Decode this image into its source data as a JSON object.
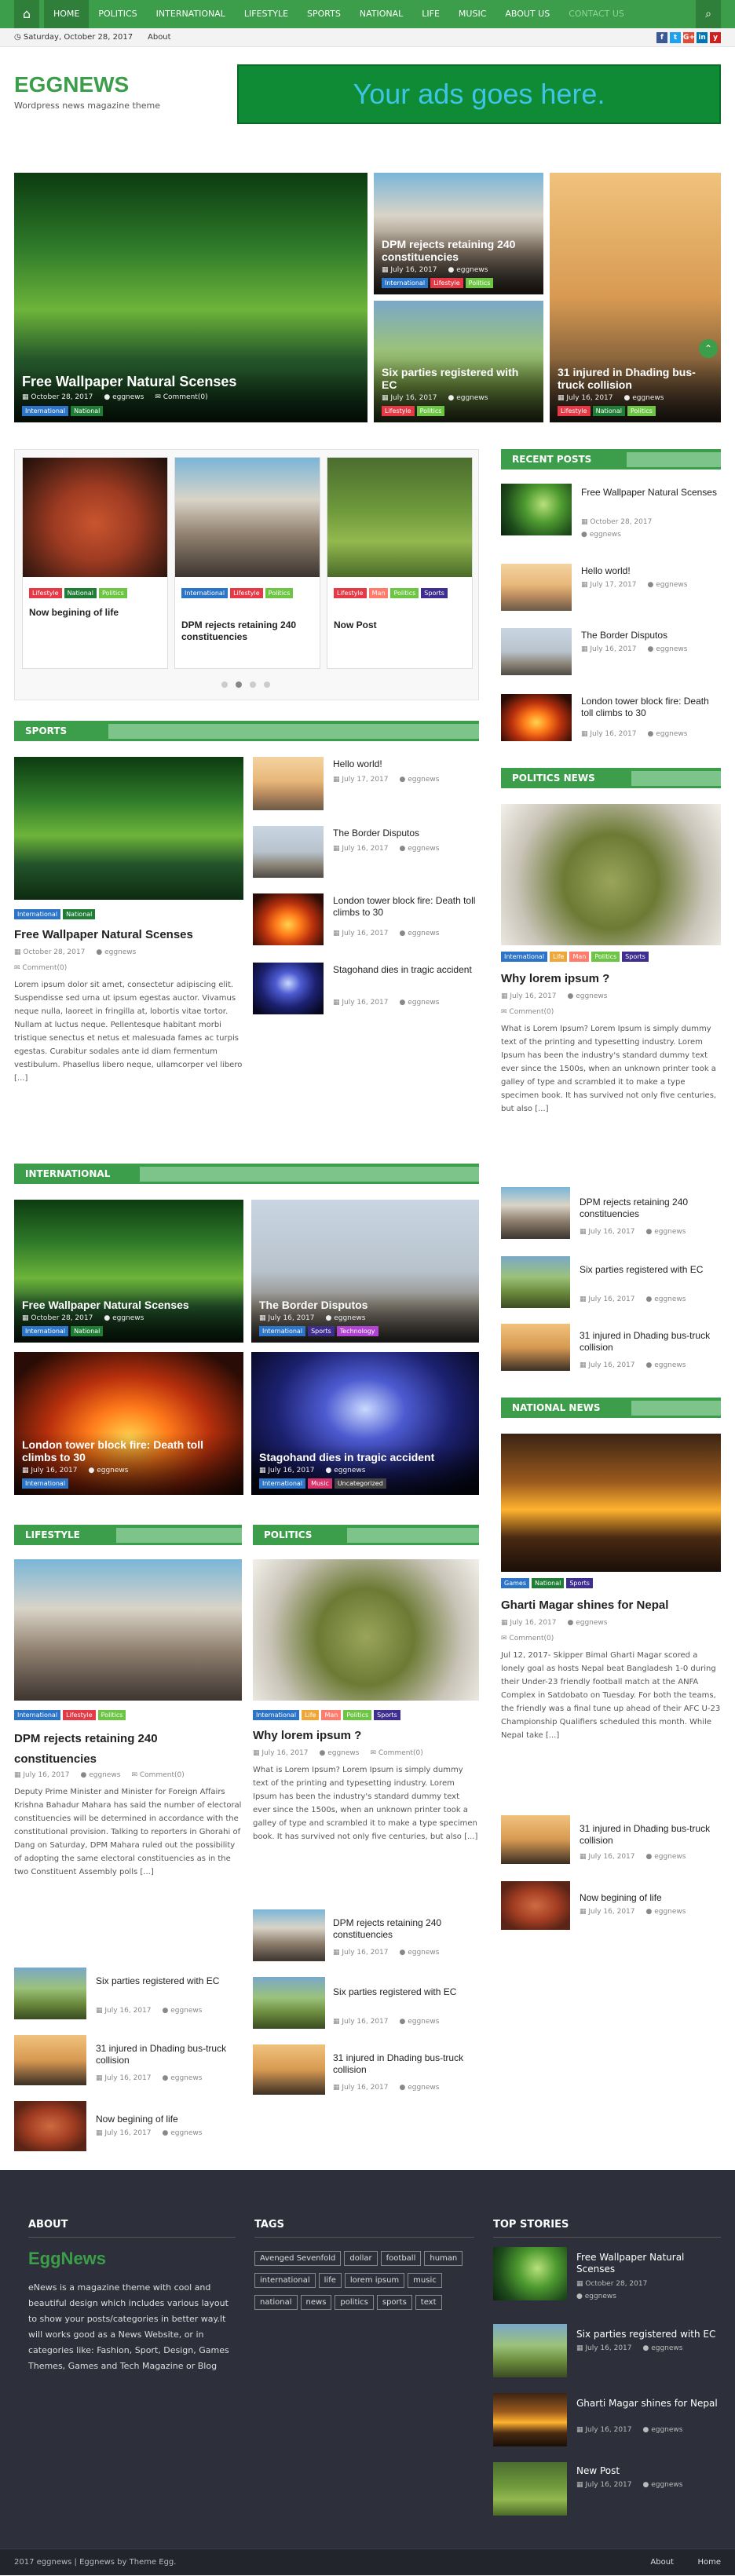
{
  "nav": {
    "items": [
      "HOME",
      "POLITICS",
      "INTERNATIONAL",
      "LIFESTYLE",
      "SPORTS",
      "NATIONAL",
      "LIFE",
      "MUSIC",
      "ABOUT US",
      "CONTACT US"
    ]
  },
  "datebar": {
    "date": "Saturday, October 28, 2017",
    "about": "About",
    "social": [
      "f",
      "t",
      "G+",
      "in",
      "y"
    ]
  },
  "header": {
    "logo": "EGGNEWS",
    "tagline": "Wordpress news magazine theme",
    "ad": "Your ads goes here."
  },
  "slider": {
    "main": {
      "title": "Free Wallpaper Natural Scenses",
      "date": "October 28, 2017",
      "author": "eggnews",
      "comments": "Comment(0)",
      "tags": [
        "International",
        "National"
      ]
    },
    "a": {
      "title": "DPM rejects retaining 240 constituencies",
      "date": "July 16, 2017",
      "author": "eggnews",
      "tags": [
        "International",
        "Lifestyle",
        "Politics"
      ]
    },
    "b": {
      "title": "Six parties registered with EC",
      "date": "July 16, 2017",
      "author": "eggnews",
      "tags": [
        "Lifestyle",
        "Politics"
      ]
    },
    "c": {
      "title": "31 injured in Dhading bus-truck collision",
      "date": "July 16, 2017",
      "author": "eggnews",
      "tags": [
        "Lifestyle",
        "National",
        "Politics"
      ]
    }
  },
  "carousel": [
    {
      "title": "Now begining of life",
      "tags": [
        "Lifestyle",
        "National",
        "Politics"
      ]
    },
    {
      "title": "DPM rejects retaining 240 constituencies",
      "tags": [
        "International",
        "Lifestyle",
        "Politics"
      ]
    },
    {
      "title": "Now Post",
      "tags": [
        "Lifestyle",
        "Man",
        "Politics",
        "Sports"
      ]
    }
  ],
  "recent_posts": {
    "heading": "RECENT POSTS",
    "items": [
      {
        "title": "Free Wallpaper Natural Scenses",
        "date": "October 28, 2017",
        "author": "eggnews"
      },
      {
        "title": "Hello world!",
        "date": "July 17, 2017",
        "author": "eggnews"
      },
      {
        "title": "The Border Disputos",
        "date": "July 16, 2017",
        "author": "eggnews"
      },
      {
        "title": "London tower block fire: Death toll climbs to 30",
        "date": "July 16, 2017",
        "author": "eggnews"
      }
    ]
  },
  "sports": {
    "heading": "SPORTS",
    "main": {
      "title": "Free Wallpaper Natural Scenses",
      "date": "October 28, 2017",
      "author": "eggnews",
      "comments": "Comment(0)",
      "tags": [
        "International",
        "National"
      ],
      "excerpt": "Lorem ipsum dolor sit amet, consectetur adipiscing elit. Suspendisse sed urna ut ipsum egestas auctor. Vivamus neque nulla, laoreet in fringilla at, lobortis vitae tortor. Nullam at luctus neque. Pellentesque habitant morbi tristique senectus et netus et malesuada fames ac turpis egestas. Curabitur sodales ante id diam fermentum vestibulum. Phasellus libero neque, ullamcorper vel libero [...]"
    },
    "list": [
      {
        "title": "Hello world!",
        "date": "July 17, 2017",
        "author": "eggnews"
      },
      {
        "title": "The Border Disputos",
        "date": "July 16, 2017",
        "author": "eggnews"
      },
      {
        "title": "London tower block fire: Death toll climbs to 30",
        "date": "July 16, 2017",
        "author": "eggnews"
      },
      {
        "title": "Stagohand dies in tragic accident",
        "date": "July 16, 2017",
        "author": "eggnews"
      }
    ]
  },
  "politics_news": {
    "heading": "POLITICS NEWS",
    "main": {
      "title": "Why lorem ipsum ?",
      "date": "July 16, 2017",
      "author": "eggnews",
      "comments": "Comment(0)",
      "tags": [
        "International",
        "Life",
        "Man",
        "Politics",
        "Sports"
      ],
      "excerpt": "What is Lorem Ipsum? Lorem Ipsum is simply dummy text of the printing and typesetting industry. Lorem Ipsum has been the industry's standard dummy text ever since the 1500s, when an unknown printer took a galley of type and scrambled it to make a type specimen book. It has survived not only five centuries, but also [...]"
    },
    "list": [
      {
        "title": "DPM rejects retaining 240 constituencies",
        "date": "July 16, 2017",
        "author": "eggnews"
      },
      {
        "title": "Six parties registered with EC",
        "date": "July 16, 2017",
        "author": "eggnews"
      },
      {
        "title": "31 injured in Dhading bus-truck collision",
        "date": "July 16, 2017",
        "author": "eggnews"
      }
    ]
  },
  "international": {
    "heading": "INTERNATIONAL",
    "items": [
      {
        "title": "Free Wallpaper Natural Scenses",
        "date": "October 28, 2017",
        "author": "eggnews",
        "tags": [
          "International",
          "National"
        ]
      },
      {
        "title": "The Border Disputos",
        "date": "July 16, 2017",
        "author": "eggnews",
        "tags": [
          "International",
          "Sports",
          "Technology"
        ]
      },
      {
        "title": "London tower block fire: Death toll climbs to 30",
        "date": "July 16, 2017",
        "author": "eggnews",
        "tags": [
          "International"
        ]
      },
      {
        "title": "Stagohand dies in tragic accident",
        "date": "July 16, 2017",
        "author": "eggnews",
        "tags": [
          "International",
          "Music",
          "Uncategorized"
        ]
      }
    ]
  },
  "national_news": {
    "heading": "NATIONAL NEWS",
    "main": {
      "title": "Gharti Magar shines for Nepal",
      "date": "July 16, 2017",
      "author": "eggnews",
      "comments": "Comment(0)",
      "tags": [
        "Games",
        "National",
        "Sports"
      ],
      "excerpt": "Jul 12, 2017- Skipper Bimal Gharti Magar scored a lonely goal as hosts Nepal beat Bangladesh 1-0 during their Under-23 friendly football match at the ANFA Complex in Satdobato on Tuesday. For both the teams, the friendly was a final tune up ahead of their AFC U-23 Championship Qualifiers scheduled this month. While Nepal take [...]"
    },
    "list": [
      {
        "title": "31 injured in Dhading bus-truck collision",
        "date": "July 16, 2017",
        "author": "eggnews"
      },
      {
        "title": "Now begining of life",
        "date": "July 16, 2017",
        "author": "eggnews"
      }
    ]
  },
  "lifestyle": {
    "heading": "LIFESTYLE",
    "main": {
      "title": "DPM rejects retaining 240 constituencies",
      "date": "July 16, 2017",
      "author": "eggnews",
      "comments": "Comment(0)",
      "tags": [
        "International",
        "Lifestyle",
        "Politics"
      ],
      "excerpt": "Deputy Prime Minister and Minister for Foreign Affairs Krishna Bahadur Mahara has said the number of electoral constituencies will be determined in accordance with the constitutional provision. Talking to reporters in Ghorahi of Dang on Saturday, DPM Mahara ruled out the possibility of adopting the same electoral constituencies as in the two Constituent Assembly polls [...]"
    },
    "list": [
      {
        "title": "Six parties registered with EC",
        "date": "July 16, 2017",
        "author": "eggnews"
      },
      {
        "title": "31 injured in Dhading bus-truck collision",
        "date": "July 16, 2017",
        "author": "eggnews"
      },
      {
        "title": "Now begining of life",
        "date": "July 16, 2017",
        "author": "eggnews"
      }
    ]
  },
  "politics": {
    "heading": "POLITICS",
    "main": {
      "title": "Why lorem ipsum ?",
      "date": "July 16, 2017",
      "author": "eggnews",
      "comments": "Comment(0)",
      "tags": [
        "International",
        "Life",
        "Man",
        "Politics",
        "Sports"
      ],
      "excerpt": "What is Lorem Ipsum? Lorem Ipsum is simply dummy text of the printing and typesetting industry. Lorem Ipsum has been the industry's standard dummy text ever since the 1500s, when an unknown printer took a galley of type and scrambled it to make a type specimen book. It has survived not only five centuries, but also [...]"
    },
    "list": [
      {
        "title": "DPM rejects retaining 240 constituencies",
        "date": "July 16, 2017",
        "author": "eggnews"
      },
      {
        "title": "Six parties registered with EC",
        "date": "July 16, 2017",
        "author": "eggnews"
      },
      {
        "title": "31 injured in Dhading bus-truck collision",
        "date": "July 16, 2017",
        "author": "eggnews"
      }
    ]
  },
  "footer": {
    "about_heading": "ABOUT",
    "about_logo": "EggNews",
    "about_text": "eNews is a magazine theme with cool and beautiful design which includes various layout to show your posts/categories in better way.It will works good as a News Website, or in categories like: Fashion, Sport, Design, Games Themes, Games and Tech Magazine or Blog",
    "tags_heading": "TAGS",
    "tags": [
      "Avenged Sevenfold",
      "dollar",
      "football",
      "human",
      "international",
      "life",
      "lorem ipsum",
      "music",
      "national",
      "news",
      "politics",
      "sports",
      "text"
    ],
    "top_heading": "TOP STORIES",
    "top": [
      {
        "title": "Free Wallpaper Natural Scenses",
        "date": "October 28, 2017",
        "author": "eggnews"
      },
      {
        "title": "Six parties registered with EC",
        "date": "July 16, 2017",
        "author": "eggnews"
      },
      {
        "title": "Gharti Magar shines for Nepal",
        "date": "July 16, 2017",
        "author": "eggnews"
      },
      {
        "title": "New Post",
        "date": "July 16, 2017",
        "author": "eggnews"
      }
    ],
    "copyright": "2017 eggnews | Eggnews by Theme Egg.",
    "links": [
      "About",
      "Home"
    ]
  }
}
